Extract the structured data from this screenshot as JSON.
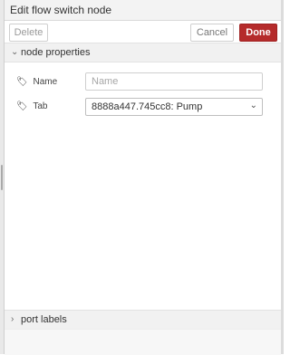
{
  "header": {
    "title": "Edit flow switch node"
  },
  "toolbar": {
    "delete_label": "Delete",
    "cancel_label": "Cancel",
    "done_label": "Done"
  },
  "sections": {
    "node_properties": {
      "label": "node properties",
      "expanded": true
    },
    "port_labels": {
      "label": "port labels",
      "expanded": false
    }
  },
  "fields": {
    "name": {
      "label": "Name",
      "placeholder": "Name",
      "value": ""
    },
    "tab": {
      "label": "Tab",
      "selected": "8888a447.745cc8: Pump"
    }
  },
  "icons": {
    "tag": "tag-icon",
    "chevron_down": "chevron-down-icon",
    "chevron_right": "chevron-right-icon"
  },
  "colors": {
    "done_bg": "#b52b2b"
  }
}
